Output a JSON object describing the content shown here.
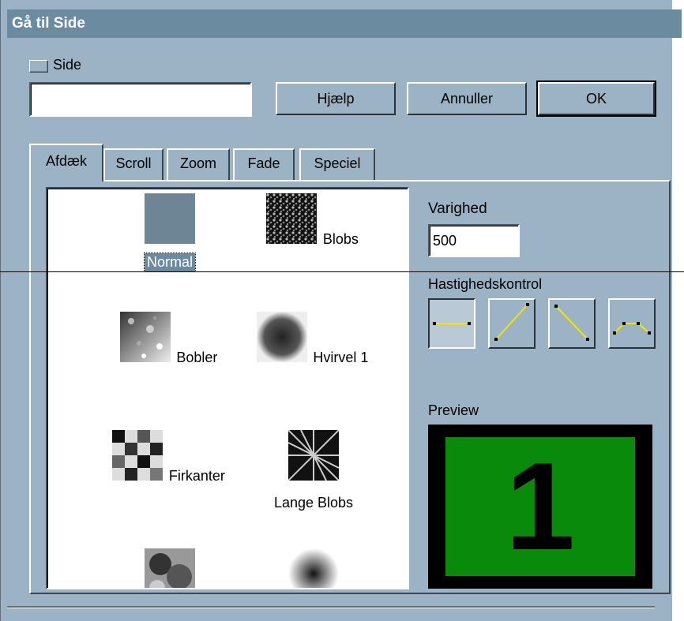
{
  "window": {
    "title": "Gå til Side"
  },
  "side_checkbox": {
    "label": "Side"
  },
  "page_input": {
    "value": ""
  },
  "buttons": {
    "help": "Hjælp",
    "cancel": "Annuller",
    "ok": "OK"
  },
  "tabs": [
    {
      "label": "Afdæk",
      "active": true
    },
    {
      "label": "Scroll",
      "active": false
    },
    {
      "label": "Zoom",
      "active": false
    },
    {
      "label": "Fade",
      "active": false
    },
    {
      "label": "Speciel",
      "active": false
    }
  ],
  "effects": [
    {
      "name": "Normal",
      "selected": true,
      "icon": "flat-swatch-icon"
    },
    {
      "name": "Blobs",
      "selected": false,
      "icon": "blobs-icon"
    },
    {
      "name": "Bobler",
      "selected": false,
      "icon": "bubbles-icon"
    },
    {
      "name": "Hvirvel 1",
      "selected": false,
      "icon": "swirl-icon"
    },
    {
      "name": "Firkanter",
      "selected": false,
      "icon": "squares-icon"
    },
    {
      "name": "Lange Blobs",
      "selected": false,
      "icon": "long-blobs-icon"
    },
    {
      "name": "",
      "selected": false,
      "icon": "cloud-icon"
    },
    {
      "name": "",
      "selected": false,
      "icon": "radial-fade-icon"
    }
  ],
  "duration": {
    "label": "Varighed",
    "value": "500"
  },
  "speed_control": {
    "label": "Hastighedskontrol",
    "options": [
      {
        "icon": "constant-speed-icon",
        "active": true
      },
      {
        "icon": "accelerate-icon",
        "active": false
      },
      {
        "icon": "decelerate-icon",
        "active": false
      },
      {
        "icon": "ease-in-out-icon",
        "active": false
      }
    ]
  },
  "preview": {
    "label": "Preview",
    "value": "1"
  },
  "colors": {
    "dialog_bg": "#9bb3c4",
    "titlebar": "#6a8ba0",
    "preview_green": "#0a8a0a"
  }
}
